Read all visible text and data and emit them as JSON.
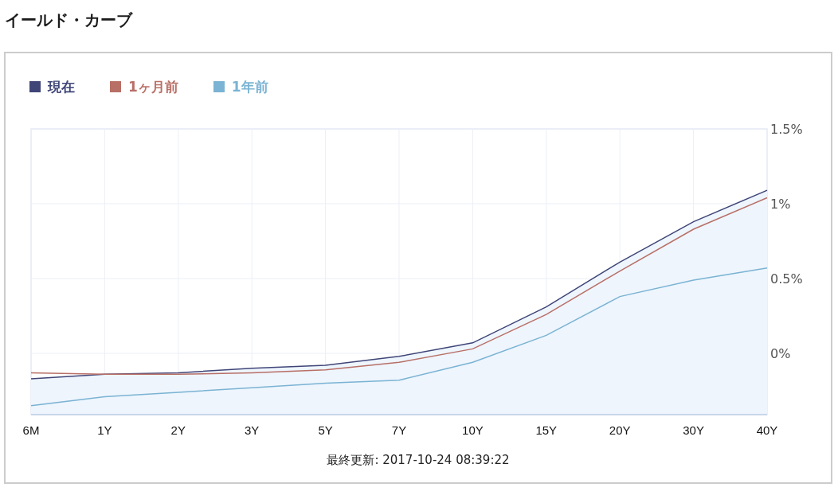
{
  "title": "イールド・カーブ",
  "chart": {
    "chart_data": {
      "type": "line",
      "grid": true,
      "categories": [
        "6M",
        "1Y",
        "2Y",
        "3Y",
        "5Y",
        "7Y",
        "10Y",
        "15Y",
        "20Y",
        "30Y",
        "40Y"
      ],
      "series": [
        {
          "name": "現在",
          "type": "area",
          "color": "#3f4577",
          "values": [
            -0.17,
            -0.14,
            -0.13,
            -0.1,
            -0.08,
            -0.02,
            0.07,
            0.31,
            0.61,
            0.88,
            1.09
          ]
        },
        {
          "name": "1ヶ月前",
          "color": "#b86f66",
          "values": [
            -0.13,
            -0.14,
            -0.14,
            -0.13,
            -0.11,
            -0.06,
            0.03,
            0.26,
            0.55,
            0.83,
            1.04
          ]
        },
        {
          "name": "1年前",
          "color": "#7ab3d3",
          "values": [
            -0.35,
            -0.29,
            -0.26,
            -0.23,
            -0.2,
            -0.18,
            -0.06,
            0.12,
            0.38,
            0.49,
            0.57
          ]
        }
      ],
      "ylim": [
        -0.41,
        1.5
      ],
      "yticks": [
        {
          "value": 0,
          "label": "0%"
        },
        {
          "value": 0.5,
          "label": "0.5%"
        },
        {
          "value": 1,
          "label": "1%"
        },
        {
          "value": 1.5,
          "label": "1.5%"
        }
      ]
    },
    "updated": "最終更新: 2017-10-24 08:39:22"
  }
}
